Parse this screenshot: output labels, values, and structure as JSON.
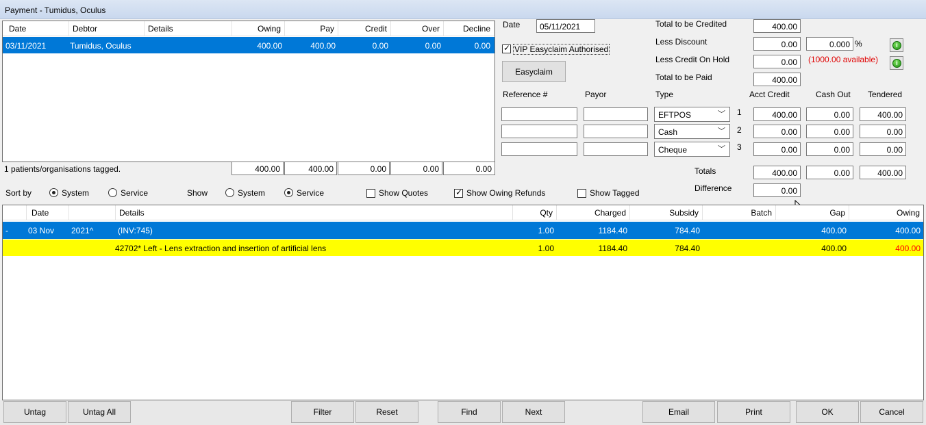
{
  "window": {
    "title": "Payment - Tumidus, Oculus"
  },
  "debtor_grid": {
    "headers": {
      "date": "Date",
      "debtor": "Debtor",
      "details": "Details",
      "owing": "Owing",
      "pay": "Pay",
      "credit": "Credit",
      "over": "Over",
      "decline": "Decline"
    },
    "rows": [
      {
        "date": "03/11/2021",
        "debtor": "Tumidus, Oculus",
        "details": "",
        "owing": "400.00",
        "pay": "400.00",
        "credit": "0.00",
        "over": "0.00",
        "decline": "0.00"
      }
    ],
    "tagged_text": "1 patients/organisations tagged.",
    "totals": {
      "owing": "400.00",
      "pay": "400.00",
      "credit": "0.00",
      "over": "0.00",
      "decline": "0.00"
    }
  },
  "payment": {
    "date_label": "Date",
    "date_value": "05/11/2021",
    "vip_label": "VIP Easyclaim Authorised",
    "vip_checked": true,
    "easyclaim_label": "Easyclaim",
    "total_credited_label": "Total to be Credited",
    "total_credited": "400.00",
    "less_discount_label": "Less Discount",
    "less_discount": "0.00",
    "discount_pct": "0.000",
    "pct_symbol": "%",
    "less_credit_hold_label": "Less Credit On Hold",
    "less_credit_hold": "0.00",
    "available_text": "(1000.00 available)",
    "total_paid_label": "Total to be Paid",
    "total_paid": "400.00",
    "info_icon_glyph": "i",
    "columns": {
      "reference": "Reference #",
      "payor": "Payor",
      "type": "Type",
      "acct_credit": "Acct Credit",
      "cash_out": "Cash Out",
      "tendered": "Tendered"
    },
    "lines": [
      {
        "num": "1",
        "reference": "",
        "payor": "",
        "type": "EFTPOS",
        "acct_credit": "400.00",
        "cash_out": "0.00",
        "tendered": "400.00"
      },
      {
        "num": "2",
        "reference": "",
        "payor": "",
        "type": "Cash",
        "acct_credit": "0.00",
        "cash_out": "0.00",
        "tendered": "0.00"
      },
      {
        "num": "3",
        "reference": "",
        "payor": "",
        "type": "Cheque",
        "acct_credit": "0.00",
        "cash_out": "0.00",
        "tendered": "0.00"
      }
    ],
    "totals_label": "Totals",
    "totals": {
      "acct_credit": "400.00",
      "cash_out": "0.00",
      "tendered": "400.00"
    },
    "difference_label": "Difference",
    "difference": "0.00"
  },
  "filters": {
    "sort_by_label": "Sort by",
    "sort_system": "System",
    "sort_service": "Service",
    "sort_selected": "System",
    "show_label": "Show",
    "show_system": "System",
    "show_service": "Service",
    "show_selected": "Service",
    "show_quotes_label": "Show Quotes",
    "show_quotes": false,
    "show_owing_refunds_label": "Show Owing Refunds",
    "show_owing_refunds": true,
    "show_tagged_label": "Show Tagged",
    "show_tagged": false
  },
  "invoice_grid": {
    "headers": {
      "date": "Date",
      "details": "Details",
      "qty": "Qty",
      "charged": "Charged",
      "subsidy": "Subsidy",
      "batch": "Batch",
      "gap": "Gap",
      "owing": "Owing"
    },
    "group_row": {
      "marker": "-",
      "date": "03 Nov",
      "year": "2021^",
      "details": "(INV:745)",
      "qty": "1.00",
      "charged": "1184.40",
      "subsidy": "784.40",
      "batch": "",
      "gap": "400.00",
      "owing": "400.00"
    },
    "item_row": {
      "details": "42702* Left - Lens extraction and insertion of artificial lens",
      "qty": "1.00",
      "charged": "1184.40",
      "subsidy": "784.40",
      "batch": "",
      "gap": "400.00",
      "owing": "400.00"
    },
    "owing_highlight_color": "#ff0000"
  },
  "buttons": {
    "untag": "Untag",
    "untag_all": "Untag All",
    "filter": "Filter",
    "reset": "Reset",
    "find": "Find",
    "next": "Next",
    "email": "Email",
    "print": "Print",
    "ok": "OK",
    "cancel": "Cancel"
  }
}
